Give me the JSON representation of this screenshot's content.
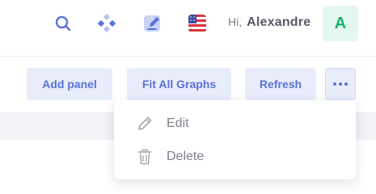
{
  "header": {
    "greeting": "Hi,",
    "user_name": "Alexandre",
    "avatar_initial": "A",
    "icons": [
      "search-icon",
      "diamond-dots-icon",
      "edit-square-icon",
      "us-flag-icon"
    ]
  },
  "toolbar": {
    "add_panel_label": "Add panel",
    "fit_all_graphs_label": "Fit All Graphs",
    "refresh_label": "Refresh",
    "more_icon": "more-horizontal-icon"
  },
  "dropdown_menu": {
    "items": [
      {
        "label": "Edit",
        "icon": "pencil-icon"
      },
      {
        "label": "Delete",
        "icon": "trash-icon"
      }
    ]
  },
  "colors": {
    "accent": "#5a72d8",
    "button_bg": "#e8ecfb",
    "avatar_bg": "#e3f7ee",
    "avatar_text": "#15b06a",
    "menu_text": "#7d7f8b"
  }
}
